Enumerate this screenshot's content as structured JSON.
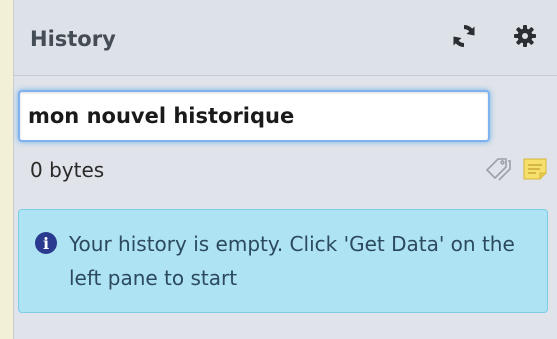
{
  "history": {
    "title": "History",
    "name_value": "mon nouvel historique",
    "size": "0 bytes",
    "empty_message": "Your history is empty. Click 'Get Data' on the left pane to start"
  },
  "icons": {
    "refresh": "refresh-icon",
    "options": "gear-icon",
    "tags": "tags-icon",
    "annotation": "note-icon",
    "info": "info-icon"
  },
  "colors": {
    "panel_bg": "#dde1e8",
    "info_bg": "#aee3f3",
    "focus_ring": "#7fb2ef"
  }
}
